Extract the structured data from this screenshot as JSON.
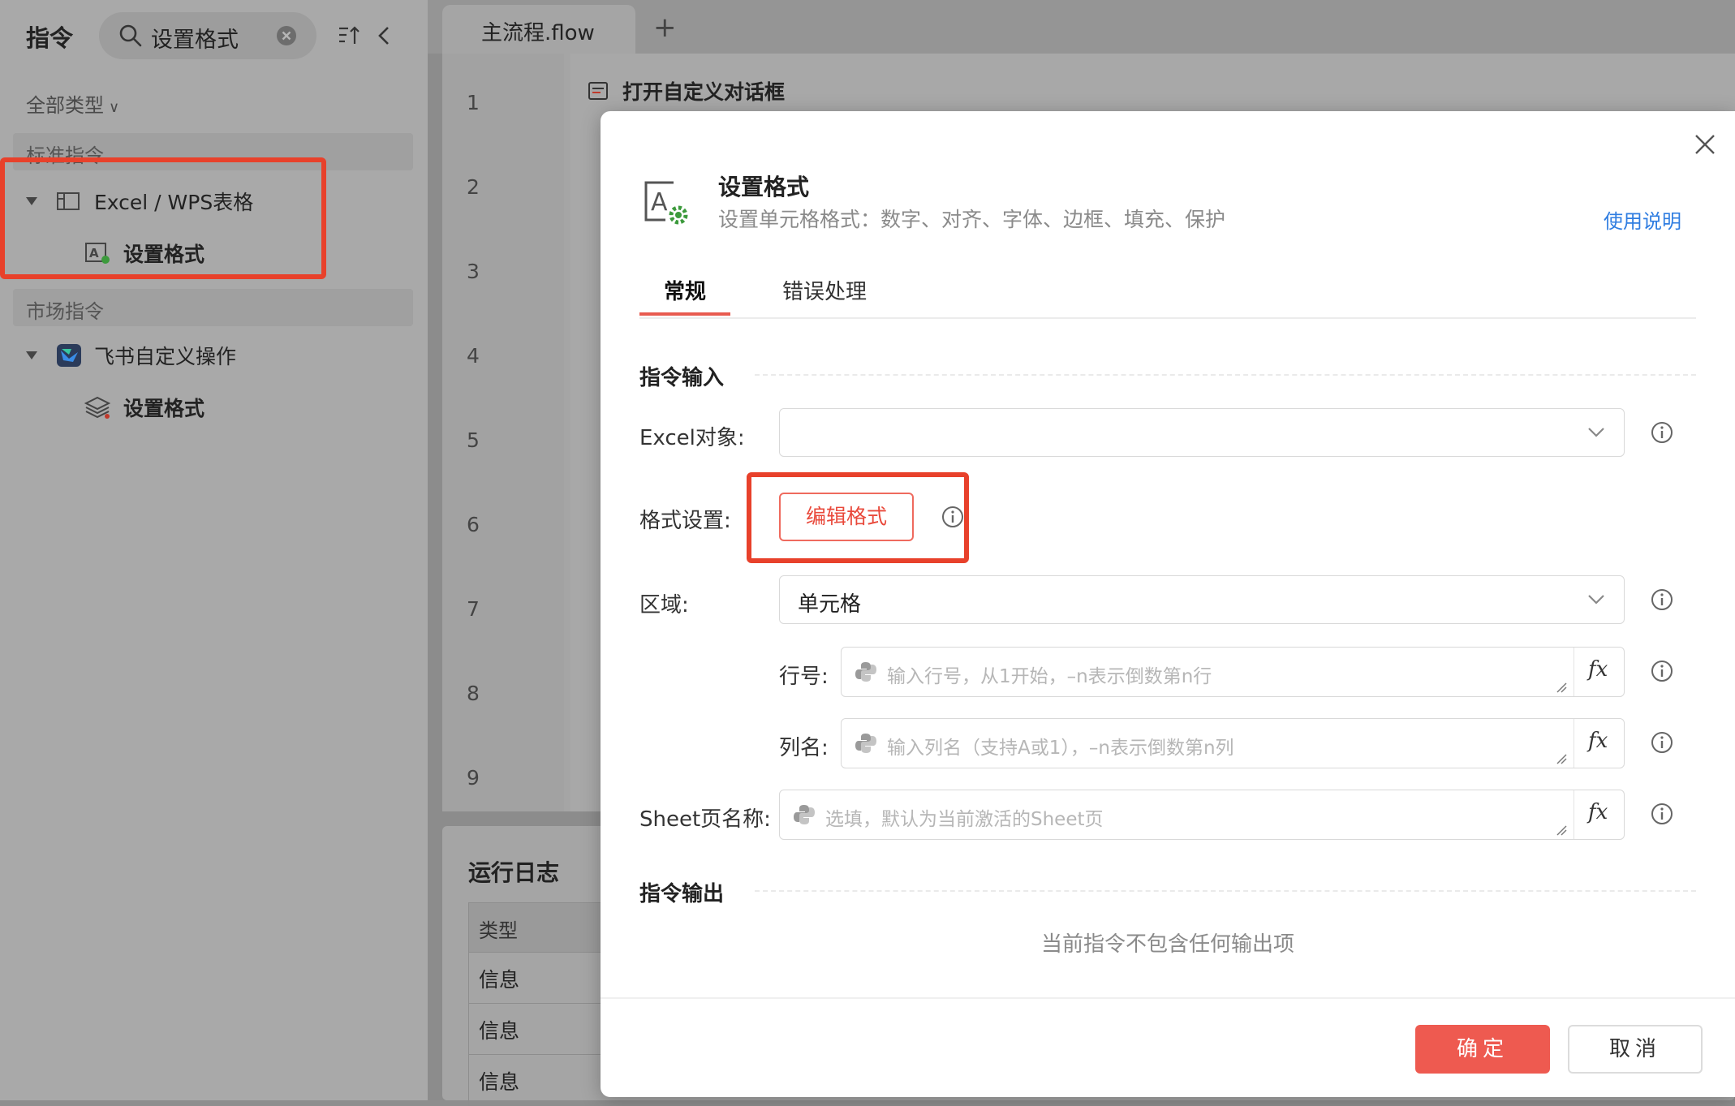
{
  "left_panel": {
    "title": "指令",
    "search_value": "设置格式",
    "type_filter": "全部类型",
    "sections": [
      {
        "label": "标准指令"
      },
      {
        "label": "市场指令"
      }
    ],
    "tree": {
      "excel_group": "Excel / WPS表格",
      "excel_item": "设置格式",
      "feishu_group": "飞书自定义操作",
      "feishu_item": "设置格式"
    }
  },
  "editor": {
    "tab_name": "主流程.flow",
    "add_tab": "+",
    "line_numbers": [
      "1",
      "2",
      "3",
      "4",
      "5",
      "6",
      "7",
      "8",
      "9"
    ],
    "step1_label": "打开自定义对话框"
  },
  "log": {
    "title": "运行日志",
    "column_type": "类型",
    "rows": [
      "信息",
      "信息",
      "信息"
    ]
  },
  "modal": {
    "title": "设置格式",
    "subtitle": "设置单元格格式：数字、对齐、字体、边框、填充、保护",
    "help_link": "使用说明",
    "tabs": [
      "常规",
      "错误处理"
    ],
    "input_section": "指令输入",
    "output_section": "指令输出",
    "excel_object_label": "Excel对象:",
    "excel_object_value": "",
    "format_label": "格式设置:",
    "edit_format_button": "编辑格式",
    "range_label": "区域:",
    "range_value": "单元格",
    "row_label": "行号:",
    "row_placeholder": "输入行号，从1开始，–n表示倒数第n行",
    "col_label": "列名:",
    "col_placeholder": "输入列名（支持A或1），–n表示倒数第n列",
    "sheet_label": "Sheet页名称:",
    "sheet_placeholder": "选填，默认为当前激活的Sheet页",
    "fx_label": "fx",
    "no_output": "当前指令不包含任何输出项",
    "ok_button": "确定",
    "cancel_button": "取消"
  },
  "colors": {
    "accent_red": "#ee5a50",
    "highlight_red": "#e8412b",
    "link_blue": "#2f7de1"
  }
}
